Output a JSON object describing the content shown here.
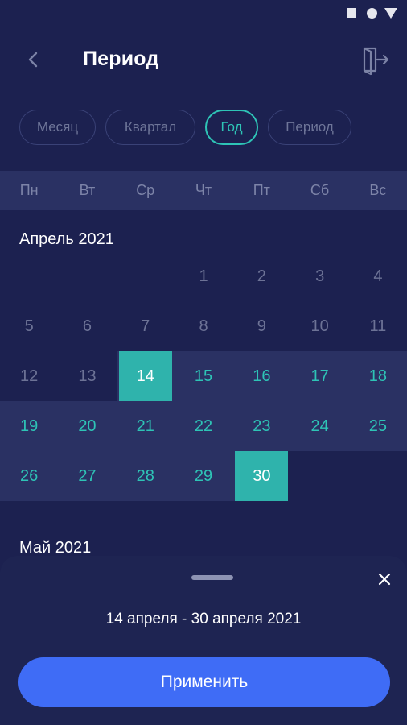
{
  "header": {
    "title": "Период",
    "back_icon": "chevron-left-icon",
    "exit_icon": "exit-door-icon"
  },
  "tabs": [
    {
      "label": "Месяц",
      "active": false
    },
    {
      "label": "Квартал",
      "active": false
    },
    {
      "label": "Год",
      "active": true
    },
    {
      "label": "Период",
      "active": false
    }
  ],
  "weekdays": [
    "Пн",
    "Вт",
    "Ср",
    "Чт",
    "Пт",
    "Сб",
    "Вс"
  ],
  "calendar": {
    "months": [
      {
        "title": "Апрель 2021",
        "weeks": [
          [
            "",
            "",
            "",
            "1",
            "2",
            "3",
            "4"
          ],
          [
            "5",
            "6",
            "7",
            "8",
            "9",
            "10",
            "11"
          ],
          [
            "12",
            "13",
            "14",
            "15",
            "16",
            "17",
            "18"
          ],
          [
            "19",
            "20",
            "21",
            "22",
            "23",
            "24",
            "25"
          ],
          [
            "26",
            "27",
            "28",
            "29",
            "30",
            "",
            ""
          ]
        ]
      },
      {
        "title": "Май 2021"
      }
    ],
    "range_start": "14",
    "range_end": "30"
  },
  "sheet": {
    "range_text": "14 апреля - 30 апреля 2021",
    "apply_label": "Применить",
    "close_icon": "close-icon"
  },
  "colors": {
    "accent": "#2ec4b6",
    "primary_button": "#3f6cf6",
    "background": "#1c2150"
  }
}
